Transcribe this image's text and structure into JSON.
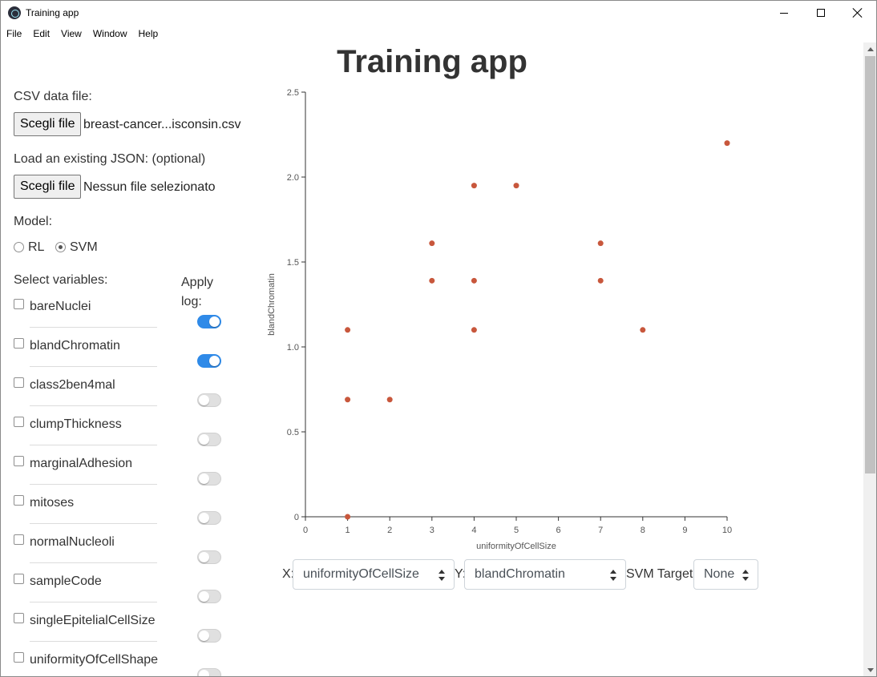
{
  "window": {
    "title": "Training app"
  },
  "menu": [
    "File",
    "Edit",
    "View",
    "Window",
    "Help"
  ],
  "page": {
    "heading": "Training app",
    "csv_label": "CSV data file:",
    "csv_button": "Scegli file",
    "csv_file": "breast-cancer...isconsin.csv",
    "json_label": "Load an existing JSON: (optional)",
    "json_button": "Scegli file",
    "json_file": "Nessun file selezionato",
    "model_label": "Model:",
    "model_options": [
      {
        "label": "RL",
        "selected": false
      },
      {
        "label": "SVM",
        "selected": true
      }
    ],
    "select_vars_label": "Select variables:",
    "apply_log_label": "Apply log:",
    "variables": [
      {
        "name": "bareNuclei",
        "checked": false,
        "log": true
      },
      {
        "name": "blandChromatin",
        "checked": false,
        "log": true
      },
      {
        "name": "class2ben4mal",
        "checked": false,
        "log": false
      },
      {
        "name": "clumpThickness",
        "checked": false,
        "log": false
      },
      {
        "name": "marginalAdhesion",
        "checked": false,
        "log": false
      },
      {
        "name": "mitoses",
        "checked": false,
        "log": false
      },
      {
        "name": "normalNucleoli",
        "checked": false,
        "log": false
      },
      {
        "name": "sampleCode",
        "checked": false,
        "log": false
      },
      {
        "name": "singleEpitelialCellSize",
        "checked": false,
        "log": false
      },
      {
        "name": "uniformityOfCellShape",
        "checked": false,
        "log": false
      }
    ],
    "x_label": "X:",
    "x_value": "uniformityOfCellSize",
    "y_label": "Y:",
    "y_value": "blandChromatin",
    "svm_target_label": "SVM Target:",
    "svm_target_value": "None"
  },
  "colors": {
    "point": "#c8573c",
    "toggle_on": "#2f8ae8",
    "axis": "#333333"
  },
  "chart_data": {
    "type": "scatter",
    "xlabel": "uniformityOfCellSize",
    "ylabel": "blandChromatin",
    "xlim": [
      0,
      10
    ],
    "ylim": [
      0,
      2.5
    ],
    "xticks": [
      "0",
      "1",
      "2",
      "3",
      "4",
      "5",
      "6",
      "7",
      "8",
      "9",
      "10"
    ],
    "yticks": [
      "0",
      "0.5",
      "1.0",
      "1.5",
      "2.0",
      "2.5"
    ],
    "grid": false,
    "points": [
      {
        "x": 1,
        "y": 0
      },
      {
        "x": 1,
        "y": 0.69
      },
      {
        "x": 1,
        "y": 1.1
      },
      {
        "x": 2,
        "y": 0.69
      },
      {
        "x": 3,
        "y": 1.39
      },
      {
        "x": 3,
        "y": 1.61
      },
      {
        "x": 4,
        "y": 1.1
      },
      {
        "x": 4,
        "y": 1.39
      },
      {
        "x": 4,
        "y": 1.95
      },
      {
        "x": 5,
        "y": 1.95
      },
      {
        "x": 7,
        "y": 1.39
      },
      {
        "x": 7,
        "y": 1.61
      },
      {
        "x": 8,
        "y": 1.1
      },
      {
        "x": 10,
        "y": 2.2
      }
    ]
  }
}
